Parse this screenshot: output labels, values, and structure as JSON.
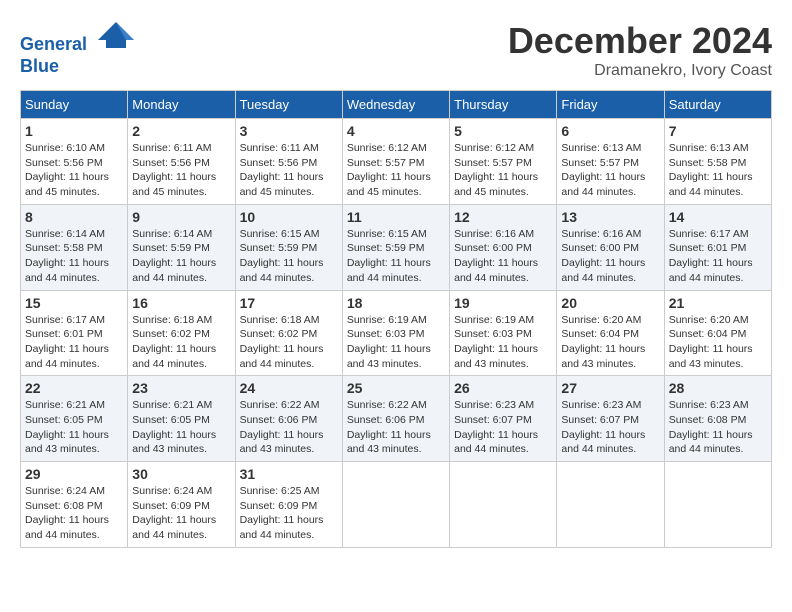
{
  "header": {
    "logo_line1": "General",
    "logo_line2": "Blue",
    "month_title": "December 2024",
    "location": "Dramanekro, Ivory Coast"
  },
  "weekdays": [
    "Sunday",
    "Monday",
    "Tuesday",
    "Wednesday",
    "Thursday",
    "Friday",
    "Saturday"
  ],
  "weeks": [
    [
      {
        "day": "1",
        "info": "Sunrise: 6:10 AM\nSunset: 5:56 PM\nDaylight: 11 hours\nand 45 minutes."
      },
      {
        "day": "2",
        "info": "Sunrise: 6:11 AM\nSunset: 5:56 PM\nDaylight: 11 hours\nand 45 minutes."
      },
      {
        "day": "3",
        "info": "Sunrise: 6:11 AM\nSunset: 5:56 PM\nDaylight: 11 hours\nand 45 minutes."
      },
      {
        "day": "4",
        "info": "Sunrise: 6:12 AM\nSunset: 5:57 PM\nDaylight: 11 hours\nand 45 minutes."
      },
      {
        "day": "5",
        "info": "Sunrise: 6:12 AM\nSunset: 5:57 PM\nDaylight: 11 hours\nand 45 minutes."
      },
      {
        "day": "6",
        "info": "Sunrise: 6:13 AM\nSunset: 5:57 PM\nDaylight: 11 hours\nand 44 minutes."
      },
      {
        "day": "7",
        "info": "Sunrise: 6:13 AM\nSunset: 5:58 PM\nDaylight: 11 hours\nand 44 minutes."
      }
    ],
    [
      {
        "day": "8",
        "info": "Sunrise: 6:14 AM\nSunset: 5:58 PM\nDaylight: 11 hours\nand 44 minutes."
      },
      {
        "day": "9",
        "info": "Sunrise: 6:14 AM\nSunset: 5:59 PM\nDaylight: 11 hours\nand 44 minutes."
      },
      {
        "day": "10",
        "info": "Sunrise: 6:15 AM\nSunset: 5:59 PM\nDaylight: 11 hours\nand 44 minutes."
      },
      {
        "day": "11",
        "info": "Sunrise: 6:15 AM\nSunset: 5:59 PM\nDaylight: 11 hours\nand 44 minutes."
      },
      {
        "day": "12",
        "info": "Sunrise: 6:16 AM\nSunset: 6:00 PM\nDaylight: 11 hours\nand 44 minutes."
      },
      {
        "day": "13",
        "info": "Sunrise: 6:16 AM\nSunset: 6:00 PM\nDaylight: 11 hours\nand 44 minutes."
      },
      {
        "day": "14",
        "info": "Sunrise: 6:17 AM\nSunset: 6:01 PM\nDaylight: 11 hours\nand 44 minutes."
      }
    ],
    [
      {
        "day": "15",
        "info": "Sunrise: 6:17 AM\nSunset: 6:01 PM\nDaylight: 11 hours\nand 44 minutes."
      },
      {
        "day": "16",
        "info": "Sunrise: 6:18 AM\nSunset: 6:02 PM\nDaylight: 11 hours\nand 44 minutes."
      },
      {
        "day": "17",
        "info": "Sunrise: 6:18 AM\nSunset: 6:02 PM\nDaylight: 11 hours\nand 44 minutes."
      },
      {
        "day": "18",
        "info": "Sunrise: 6:19 AM\nSunset: 6:03 PM\nDaylight: 11 hours\nand 43 minutes."
      },
      {
        "day": "19",
        "info": "Sunrise: 6:19 AM\nSunset: 6:03 PM\nDaylight: 11 hours\nand 43 minutes."
      },
      {
        "day": "20",
        "info": "Sunrise: 6:20 AM\nSunset: 6:04 PM\nDaylight: 11 hours\nand 43 minutes."
      },
      {
        "day": "21",
        "info": "Sunrise: 6:20 AM\nSunset: 6:04 PM\nDaylight: 11 hours\nand 43 minutes."
      }
    ],
    [
      {
        "day": "22",
        "info": "Sunrise: 6:21 AM\nSunset: 6:05 PM\nDaylight: 11 hours\nand 43 minutes."
      },
      {
        "day": "23",
        "info": "Sunrise: 6:21 AM\nSunset: 6:05 PM\nDaylight: 11 hours\nand 43 minutes."
      },
      {
        "day": "24",
        "info": "Sunrise: 6:22 AM\nSunset: 6:06 PM\nDaylight: 11 hours\nand 43 minutes."
      },
      {
        "day": "25",
        "info": "Sunrise: 6:22 AM\nSunset: 6:06 PM\nDaylight: 11 hours\nand 43 minutes."
      },
      {
        "day": "26",
        "info": "Sunrise: 6:23 AM\nSunset: 6:07 PM\nDaylight: 11 hours\nand 44 minutes."
      },
      {
        "day": "27",
        "info": "Sunrise: 6:23 AM\nSunset: 6:07 PM\nDaylight: 11 hours\nand 44 minutes."
      },
      {
        "day": "28",
        "info": "Sunrise: 6:23 AM\nSunset: 6:08 PM\nDaylight: 11 hours\nand 44 minutes."
      }
    ],
    [
      {
        "day": "29",
        "info": "Sunrise: 6:24 AM\nSunset: 6:08 PM\nDaylight: 11 hours\nand 44 minutes."
      },
      {
        "day": "30",
        "info": "Sunrise: 6:24 AM\nSunset: 6:09 PM\nDaylight: 11 hours\nand 44 minutes."
      },
      {
        "day": "31",
        "info": "Sunrise: 6:25 AM\nSunset: 6:09 PM\nDaylight: 11 hours\nand 44 minutes."
      },
      {
        "day": "",
        "info": ""
      },
      {
        "day": "",
        "info": ""
      },
      {
        "day": "",
        "info": ""
      },
      {
        "day": "",
        "info": ""
      }
    ]
  ]
}
